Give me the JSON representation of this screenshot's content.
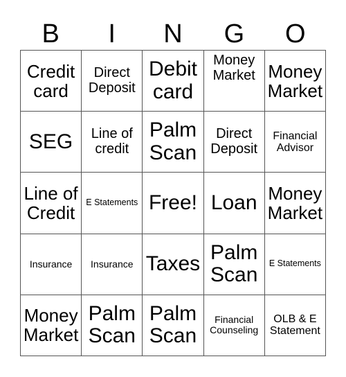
{
  "header": {
    "letters": [
      "B",
      "I",
      "N",
      "G",
      "O"
    ]
  },
  "cells": [
    {
      "text": "Credit card"
    },
    {
      "text": "Direct Deposit"
    },
    {
      "text": "Debit card"
    },
    {
      "text": "Money Market"
    },
    {
      "text": "Money Market"
    },
    {
      "text": "SEG"
    },
    {
      "text": "Line of credit"
    },
    {
      "text": "Palm Scan"
    },
    {
      "text": "Direct Deposit"
    },
    {
      "text": "Financial Advisor"
    },
    {
      "text": "Line of Credit"
    },
    {
      "text": "E Statements"
    },
    {
      "text": "Free!"
    },
    {
      "text": "Loan"
    },
    {
      "text": "Money Market"
    },
    {
      "text": "Insurance"
    },
    {
      "text": "Insurance"
    },
    {
      "text": "Taxes"
    },
    {
      "text": "Palm Scan"
    },
    {
      "text": "E Statements"
    },
    {
      "text": "Money Market"
    },
    {
      "text": "Palm Scan"
    },
    {
      "text": "Palm Scan"
    },
    {
      "text": "Financial Counseling"
    },
    {
      "text": "OLB & E Statement"
    }
  ]
}
